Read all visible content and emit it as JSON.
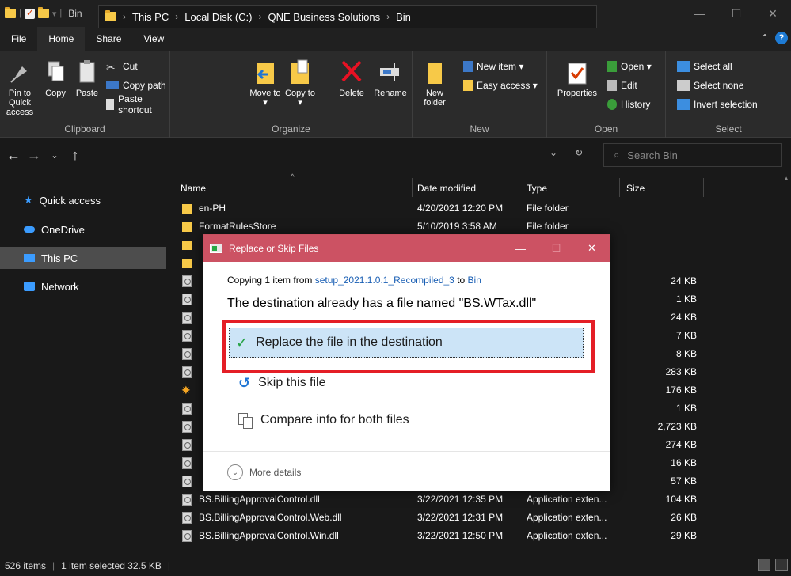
{
  "window": {
    "title": "Bin",
    "controls": {
      "minimize": "—",
      "maximize": "☐",
      "close": "✕"
    }
  },
  "ribbon_tabs": [
    {
      "label": "File"
    },
    {
      "label": "Home",
      "active": true
    },
    {
      "label": "Share"
    },
    {
      "label": "View"
    }
  ],
  "ribbon": {
    "clipboard": {
      "label": "Clipboard",
      "pin": "Pin to Quick access",
      "copy": "Copy",
      "paste": "Paste",
      "cut": "Cut",
      "copy_path": "Copy path",
      "paste_shortcut": "Paste shortcut"
    },
    "organize": {
      "label": "Organize",
      "move_to": "Move to ▾",
      "copy_to": "Copy to ▾",
      "delete": "Delete",
      "rename": "Rename"
    },
    "new": {
      "label": "New",
      "new_folder": "New folder",
      "new_item": "New item ▾",
      "easy_access": "Easy access ▾"
    },
    "open": {
      "label": "Open",
      "properties": "Properties",
      "open": "Open ▾",
      "edit": "Edit",
      "history": "History"
    },
    "select": {
      "label": "Select",
      "select_all": "Select all",
      "select_none": "Select none",
      "invert": "Invert selection"
    }
  },
  "address": {
    "crumbs": [
      "This PC",
      "Local Disk (C:)",
      "QNE Business Solutions",
      "Bin"
    ],
    "search_placeholder": "Search Bin"
  },
  "nav": [
    {
      "label": "Quick access"
    },
    {
      "label": "OneDrive"
    },
    {
      "label": "This PC",
      "selected": true
    },
    {
      "label": "Network"
    }
  ],
  "columns": {
    "name": "Name",
    "date": "Date modified",
    "type": "Type",
    "size": "Size"
  },
  "files": [
    {
      "name": "en-PH",
      "date": "4/20/2021 12:20 PM",
      "type": "File folder",
      "size": "",
      "kind": "folder"
    },
    {
      "name": "FormatRulesStore",
      "date": "5/10/2019 3:58 AM",
      "type": "File folder",
      "size": "",
      "kind": "folder"
    },
    {
      "name": "BS.BillingApprovalControl.dll",
      "date": "3/22/2021 12:35 PM",
      "type": "Application exten...",
      "size": "104 KB",
      "kind": "dll"
    },
    {
      "name": "BS.BillingApprovalControl.Web.dll",
      "date": "3/22/2021 12:31 PM",
      "type": "Application exten...",
      "size": "26 KB",
      "kind": "dll"
    },
    {
      "name": "BS.BillingApprovalControl.Win.dll",
      "date": "3/22/2021 12:50 PM",
      "type": "Application exten...",
      "size": "29 KB",
      "kind": "dll"
    }
  ],
  "partial_sizes": [
    "24 KB",
    "1 KB",
    "24 KB",
    "7 KB",
    "8 KB",
    "283 KB",
    "176 KB",
    "1 KB",
    "2,723 KB",
    "274 KB",
    "16 KB",
    "57 KB"
  ],
  "status": {
    "items": "526 items",
    "selected": "1 item selected  32.5 KB"
  },
  "dialog": {
    "title": "Replace or Skip Files",
    "copying_prefix": "Copying 1 item from ",
    "source": "setup_2021.1.0.1_Recompiled_3",
    "to_word": " to ",
    "dest": "Bin",
    "message": "The destination already has a file named \"BS.WTax.dll\"",
    "replace": "Replace the file in the destination",
    "skip": "Skip this file",
    "compare": "Compare info for both files",
    "more": "More details"
  }
}
